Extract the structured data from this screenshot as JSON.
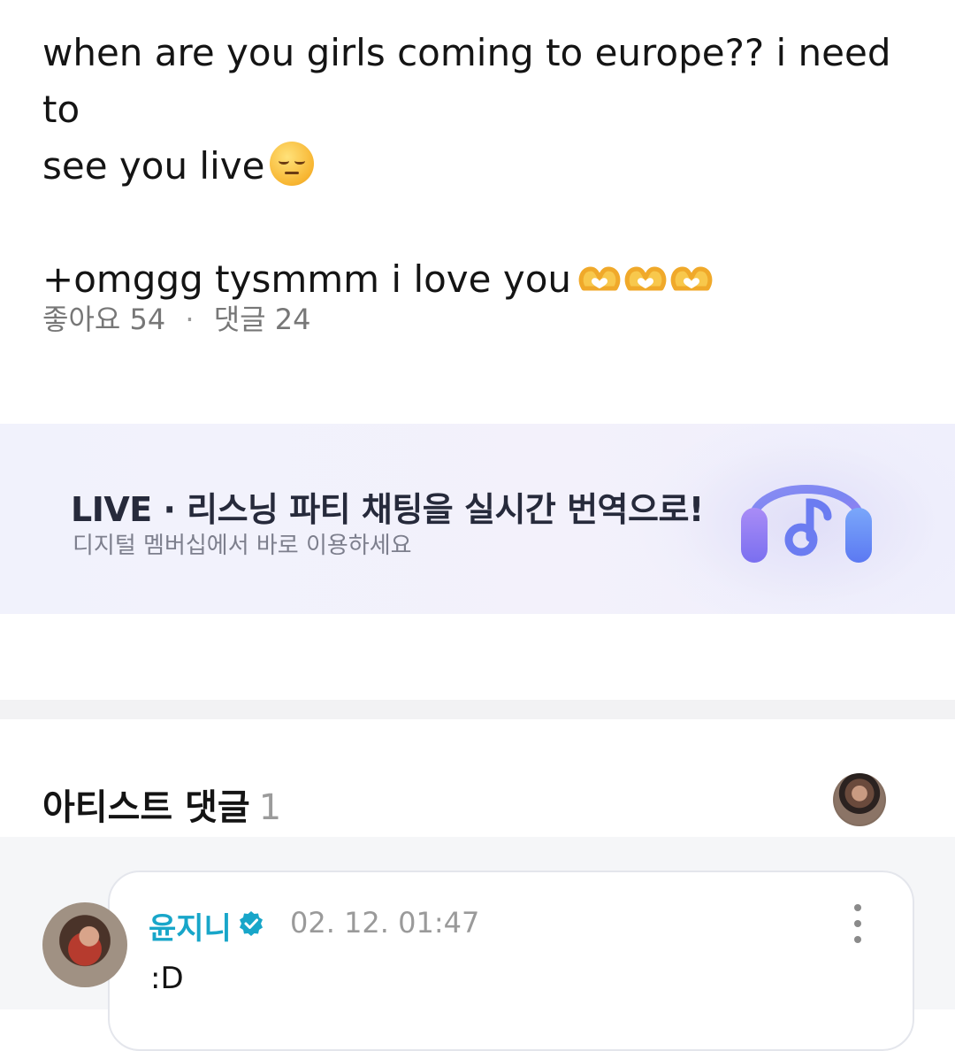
{
  "post": {
    "line1": "when are you girls coming to europe?? i need to",
    "line2": "see you live",
    "line3": "+omggg tysmmm i love you",
    "line2_emoji": "pensive-face-emoji",
    "line3_emoji": "heart-hands-emoji"
  },
  "meta": {
    "likes_label": "좋아요",
    "likes_count": "54",
    "separator": "·",
    "comments_label": "댓글",
    "comments_count": "24"
  },
  "banner": {
    "title": "LIVE · 리스닝 파티 채팅을 실시간 번역으로!",
    "subtitle": "디지털 멤버십에서 바로 이용하세요",
    "icon": "headphones-music-icon"
  },
  "artist_comments": {
    "title": "아티스트 댓글",
    "count": "1"
  },
  "comment": {
    "author": "윤지니",
    "time": "02. 12. 01:47",
    "text": ":D",
    "verified_icon": "verified-badge-icon",
    "more_icon": "more-vertical-icon"
  },
  "colors": {
    "accent_name": "#18a6c9",
    "meta_gray": "#777777",
    "banner_bg": "#f1f2fc",
    "emoji_yellow": "#f3b634"
  }
}
